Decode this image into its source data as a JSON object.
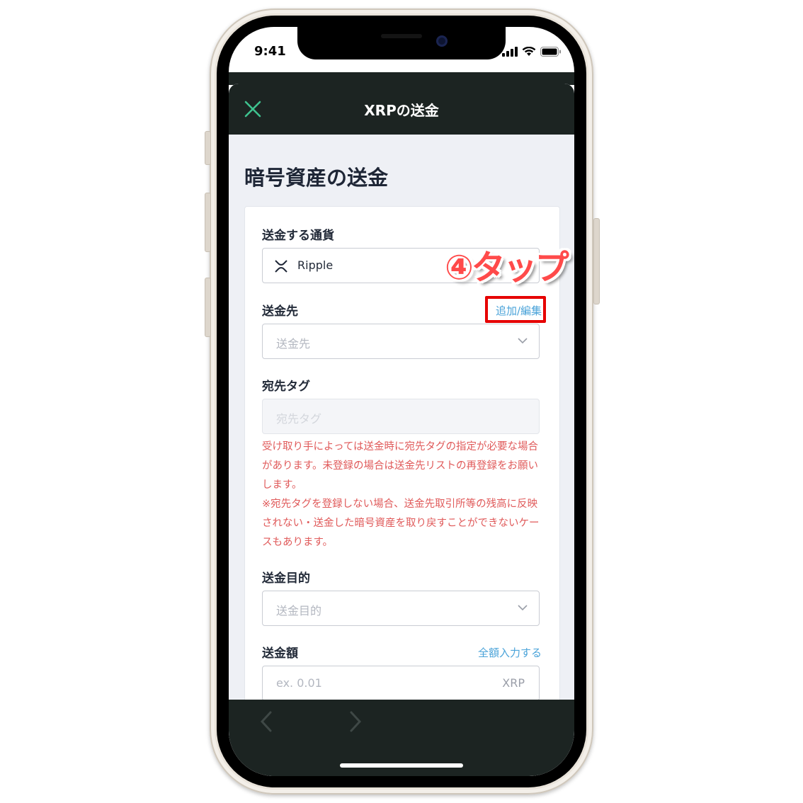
{
  "status": {
    "time": "9:41"
  },
  "header": {
    "title": "XRPの送金"
  },
  "page": {
    "title": "暗号資産の送金"
  },
  "form": {
    "currency": {
      "label": "送金する通貨",
      "value": "Ripple"
    },
    "destination": {
      "label": "送金先",
      "link": "追加/編集",
      "placeholder": "送金先"
    },
    "tag": {
      "label": "宛先タグ",
      "placeholder": "宛先タグ",
      "warning": [
        "受け取り手によっては送金時に宛先タグの指定が必要な場合があります。未登録の場合は送金先リストの再登録をお願いします。",
        "※宛先タグを登録しない場合、送金先取引所等の残高に反映されない・送金した暗号資産を取り戻すことができないケースもあります。"
      ]
    },
    "purpose": {
      "label": "送金目的",
      "placeholder": "送金目的"
    },
    "amount": {
      "label": "送金額",
      "link": "全額入力する",
      "placeholder": "ex. 0.01",
      "unit": "XRP"
    }
  },
  "annotation": {
    "text": "④タップ",
    "color": "#e60000"
  },
  "colors": {
    "accent": "#4aa3d9",
    "header_bg": "#1c2422",
    "warning": "#e05a5a",
    "close_icon": "#3ec28f"
  },
  "icons": [
    "close-icon",
    "xrp-icon",
    "chevron-down-icon",
    "back-arrow-icon",
    "forward-arrow-icon",
    "signal-icon",
    "wifi-icon",
    "battery-icon"
  ]
}
